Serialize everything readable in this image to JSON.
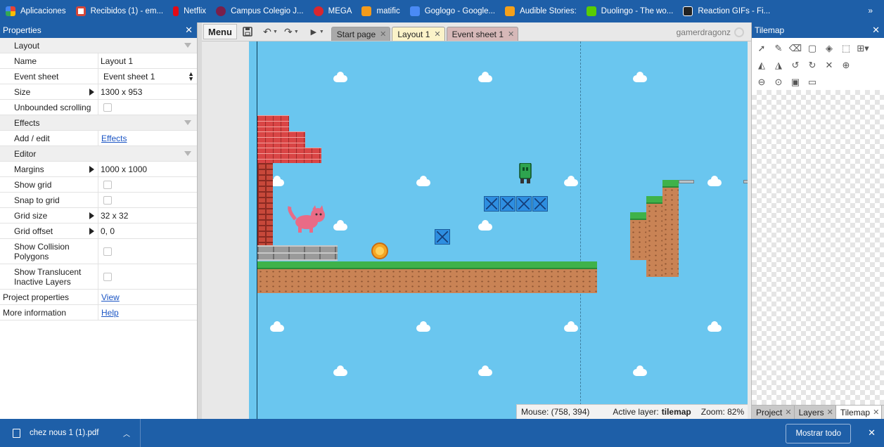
{
  "bookmarks": {
    "items": [
      {
        "label": "Aplicaciones",
        "color": "#e8453c",
        "icon": "apps-grid-icon"
      },
      {
        "label": "Recibidos (1) - em...",
        "color": "#d44638",
        "icon": "gmail-icon"
      },
      {
        "label": "Netflix",
        "color": "#e50914",
        "icon": "netflix-icon"
      },
      {
        "label": "Campus Colegio J...",
        "color": "#7a1f4b",
        "icon": "campus-icon"
      },
      {
        "label": "MEGA",
        "color": "#d9272e",
        "icon": "mega-icon"
      },
      {
        "label": "matific",
        "color": "#f39b1c",
        "icon": "matific-icon"
      },
      {
        "label": "Goglogo - Google...",
        "color": "#4a8af4",
        "icon": "goglogo-icon"
      },
      {
        "label": "Audible Stories:",
        "color": "#f4a01a",
        "icon": "audible-icon"
      },
      {
        "label": "Duolingo - The wo...",
        "color": "#58cc02",
        "icon": "duolingo-icon"
      },
      {
        "label": "Reaction GIFs - Fi...",
        "color": "#222222",
        "icon": "reactiongifs-icon"
      }
    ],
    "more": "»"
  },
  "properties": {
    "title": "Properties",
    "close": "✕",
    "layout_section": "Layout",
    "name_label": "Name",
    "name_value": "Layout 1",
    "event_sheet_label": "Event sheet",
    "event_sheet_value": "Event sheet 1",
    "size_label": "Size",
    "size_value": "1300 x 953",
    "unbounded_label": "Unbounded scrolling",
    "effects_section": "Effects",
    "add_edit_label": "Add / edit",
    "add_edit_link": "Effects",
    "editor_section": "Editor",
    "margins_label": "Margins",
    "margins_value": "1000 x 1000",
    "show_grid_label": "Show grid",
    "snap_label": "Snap to grid",
    "grid_size_label": "Grid size",
    "grid_size_value": "32 x 32",
    "grid_offset_label": "Grid offset",
    "grid_offset_value": "0, 0",
    "collision_label": "Show Collision Polygons",
    "translucent_label": "Show Translucent Inactive Layers",
    "project_props_label": "Project properties",
    "project_props_link": "View",
    "more_info_label": "More information",
    "more_info_link": "Help"
  },
  "toolbar": {
    "menu": "Menu",
    "tabs": [
      {
        "label": "Start page",
        "active": false,
        "color": "#a9a9a9"
      },
      {
        "label": "Layout 1",
        "active": true,
        "color": "#fbf3c9"
      },
      {
        "label": "Event sheet 1",
        "active": false,
        "color": "#d6b8b8"
      }
    ],
    "user": "gamerdragonz"
  },
  "status": {
    "mouse": "Mouse: (758, 394)",
    "active_layer_label": "Active layer:",
    "active_layer": "tilemap",
    "zoom": "Zoom: 82%"
  },
  "tilemap": {
    "title": "Tilemap",
    "close": "✕",
    "tools": [
      "pointer-icon",
      "pencil-icon",
      "eraser-icon",
      "rectangle-icon",
      "fill-bucket-icon",
      "selection-icon",
      "tile-grid-icon",
      "flip-horizontal-icon",
      "flip-vertical-icon",
      "rotate-left-icon",
      "rotate-right-icon",
      "clear-icon",
      "zoom-in-icon",
      "zoom-out-icon",
      "zoom-reset-icon",
      "save-icon",
      "folder-icon"
    ],
    "bottom_tabs": [
      {
        "label": "Project",
        "active": false
      },
      {
        "label": "Layers",
        "active": false
      },
      {
        "label": "Tilemap",
        "active": true
      }
    ]
  },
  "downloads": {
    "file": "chez nous 1 (1).pdf",
    "show_all": "Mostrar todo",
    "close": "✕"
  },
  "colors": {
    "chrome_blue": "#1e5fa8",
    "sky": "#6ac6ef",
    "grass": "#3fb24a",
    "dirt": "#c98355",
    "brick": "#d94545",
    "block": "#2e8ee0"
  }
}
